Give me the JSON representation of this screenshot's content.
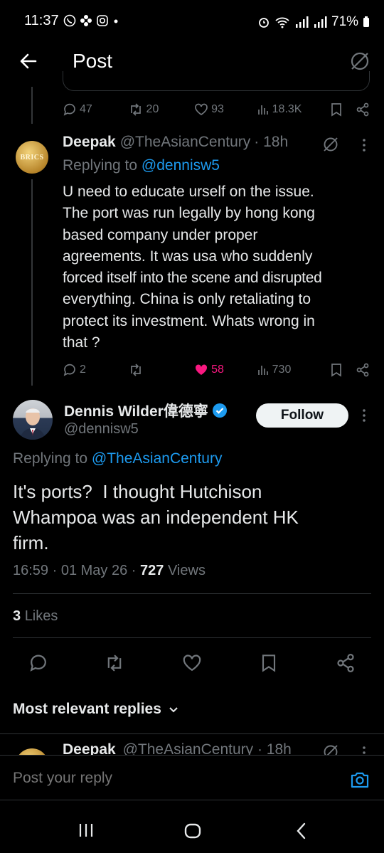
{
  "status_bar": {
    "time": "11:37",
    "battery": "71%"
  },
  "header": {
    "title": "Post"
  },
  "parent_actions": {
    "replies": "47",
    "reposts": "20",
    "likes": "93",
    "views": "18.3K"
  },
  "reply1": {
    "author": "Deepak",
    "handle": "@TheAsianCentury",
    "time": "· 18h",
    "replying_prefix": "Replying to",
    "replying_to": "@dennisw5",
    "body_lines": [
      "U need to educate urself on the issue.",
      "The port was run legally by hong kong",
      "based company under proper",
      "agreements. It was usa who suddenly",
      "forced itself into the scene and disrupted",
      "everything. China is only retaliating to",
      "protect its investment. Whats wrong in",
      "that ?"
    ],
    "avatar_text": "BRICS",
    "replies": "2",
    "likes": "58",
    "views": "730"
  },
  "main_post": {
    "author": "Dennis Wilder偉德寧",
    "handle": "@dennisw5",
    "follow_label": "Follow",
    "replying_prefix": "Replying to",
    "replying_to": "@TheAsianCentury",
    "body_lines": [
      "It's ports?  I thought Hutchison",
      "Whampoa was an independent HK",
      "firm."
    ],
    "time": "16:59",
    "date": "01 May 26",
    "views_count": "727",
    "views_label": "Views",
    "likes_count": "3",
    "likes_label": "Likes"
  },
  "replies_section": {
    "sort_label": "Most relevant replies",
    "next_author": "Deepak",
    "next_handle": "@TheAsianCentury",
    "next_time": "· 18h"
  },
  "composer": {
    "placeholder": "Post your reply"
  },
  "colors": {
    "background": "#000000",
    "text": "#e7e9ea",
    "muted": "#71767b",
    "accent": "#1d9bf0",
    "like": "#f91880"
  }
}
